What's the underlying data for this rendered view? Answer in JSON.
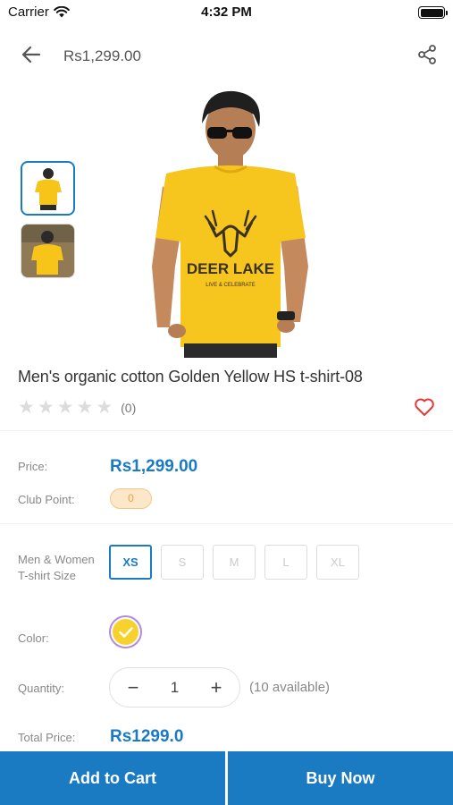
{
  "status": {
    "carrier": "Carrier",
    "time": "4:32 PM"
  },
  "header": {
    "price": "Rs1,299.00"
  },
  "product": {
    "name": "Men's organic cotton Golden Yellow HS t-shirt-08",
    "rating_count": "(0)",
    "rating_value": 0,
    "shirt_print": "DEER LAKE",
    "shirt_subprint": "LIVE & CELEBRATE"
  },
  "details": {
    "price_label": "Price:",
    "price_value": "Rs1,299.00",
    "club_label": "Club Point:",
    "club_value": "0",
    "size_label": "Men & Women T-shirt Size",
    "sizes": [
      "XS",
      "S",
      "M",
      "L",
      "XL"
    ],
    "selected_size": "XS",
    "color_label": "Color:",
    "selected_color": "#f7d22e",
    "qty_label": "Quantity:",
    "qty_minus": "−",
    "qty_plus": "+",
    "qty_value": "1",
    "availability": "(10 available)",
    "total_label": "Total Price:",
    "total_value": "Rs1299.0"
  },
  "actions": {
    "add_to_cart": "Add to Cart",
    "buy_now": "Buy Now"
  },
  "colors": {
    "accent": "#1a7ac2",
    "wishlist": "#e53935",
    "club_badge_bg": "#fde7c9"
  },
  "icons": [
    "wifi-icon",
    "battery-icon",
    "back-arrow-icon",
    "share-icon",
    "heart-icon",
    "check-icon",
    "star-icon"
  ]
}
